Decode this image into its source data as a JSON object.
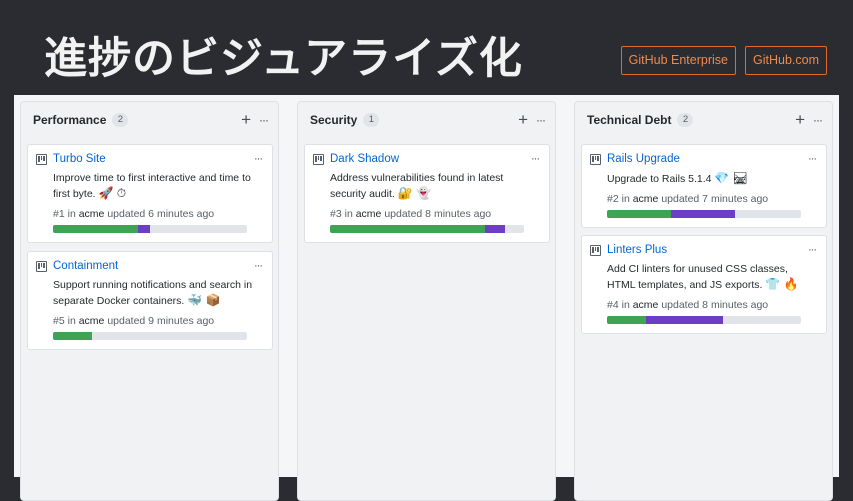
{
  "slide_title": "進捗のビジュアライズ化",
  "tags": [
    "GitHub Enterprise",
    "GitHub.com"
  ],
  "columns": [
    {
      "name": "Performance",
      "count": "2",
      "add_icon": "plus-icon",
      "menu_icon": "more-icon",
      "cards": [
        {
          "title": "Turbo Site",
          "desc": "Improve time to first interactive and time to first byte.",
          "emoji": "🚀 ⏱",
          "number": "#1",
          "repo": "acme",
          "updated": "updated 6 minutes ago",
          "done": 0.44,
          "in_progress": 0.06
        },
        {
          "title": "Containment",
          "desc": "Support running notifications and search in separate Docker containers.",
          "emoji": "🐳 📦",
          "number": "#5",
          "repo": "acme",
          "updated": "updated 9 minutes ago",
          "done": 0.2,
          "in_progress": 0.0
        }
      ]
    },
    {
      "name": "Security",
      "count": "1",
      "add_icon": "plus-icon",
      "menu_icon": "more-icon",
      "cards": [
        {
          "title": "Dark Shadow",
          "desc": "Address vulnerabilities found in latest security audit.",
          "emoji": "🔐 👻",
          "number": "#3",
          "repo": "acme",
          "updated": "updated 8 minutes ago",
          "done": 0.8,
          "in_progress": 0.1
        }
      ]
    },
    {
      "name": "Technical Debt",
      "count": "2",
      "add_icon": "plus-icon",
      "menu_icon": "more-icon",
      "cards": [
        {
          "title": "Rails Upgrade",
          "desc": "Upgrade to Rails 5.1.4",
          "emoji": "💎 🛤",
          "number": "#2",
          "repo": "acme",
          "updated": "updated 7 minutes ago",
          "done": 0.33,
          "in_progress": 0.33
        },
        {
          "title": "Linters Plus",
          "desc": "Add CI linters for unused CSS classes, HTML templates, and JS exports.",
          "emoji": "👕 🔥",
          "number": "#4",
          "repo": "acme",
          "updated": "updated 8 minutes ago",
          "done": 0.2,
          "in_progress": 0.4
        }
      ]
    }
  ],
  "colors": {
    "done": "#3ea453",
    "in_progress": "#6b3ec4",
    "link": "#0366d6",
    "tag": "#e8672c"
  }
}
